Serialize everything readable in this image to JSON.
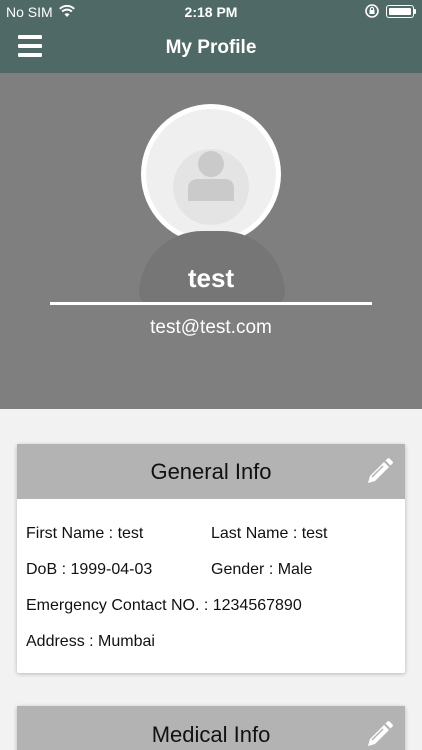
{
  "status_bar": {
    "carrier": "No SIM",
    "time": "2:18 PM"
  },
  "nav": {
    "title": "My Profile"
  },
  "profile": {
    "name": "test",
    "email": "test@test.com"
  },
  "general_info": {
    "title": "General Info",
    "first_name": "First Name : test",
    "last_name": "Last Name : test",
    "dob": "DoB : 1999-04-03",
    "gender": "Gender : Male",
    "emergency_contact": "Emergency Contact NO. : 1234567890",
    "address": "Address : Mumbai"
  },
  "medical_info": {
    "title": "Medical Info"
  },
  "colors": {
    "nav": "#4f6a66",
    "header": "#7f7f7f",
    "card_head": "#b3b3b3"
  }
}
